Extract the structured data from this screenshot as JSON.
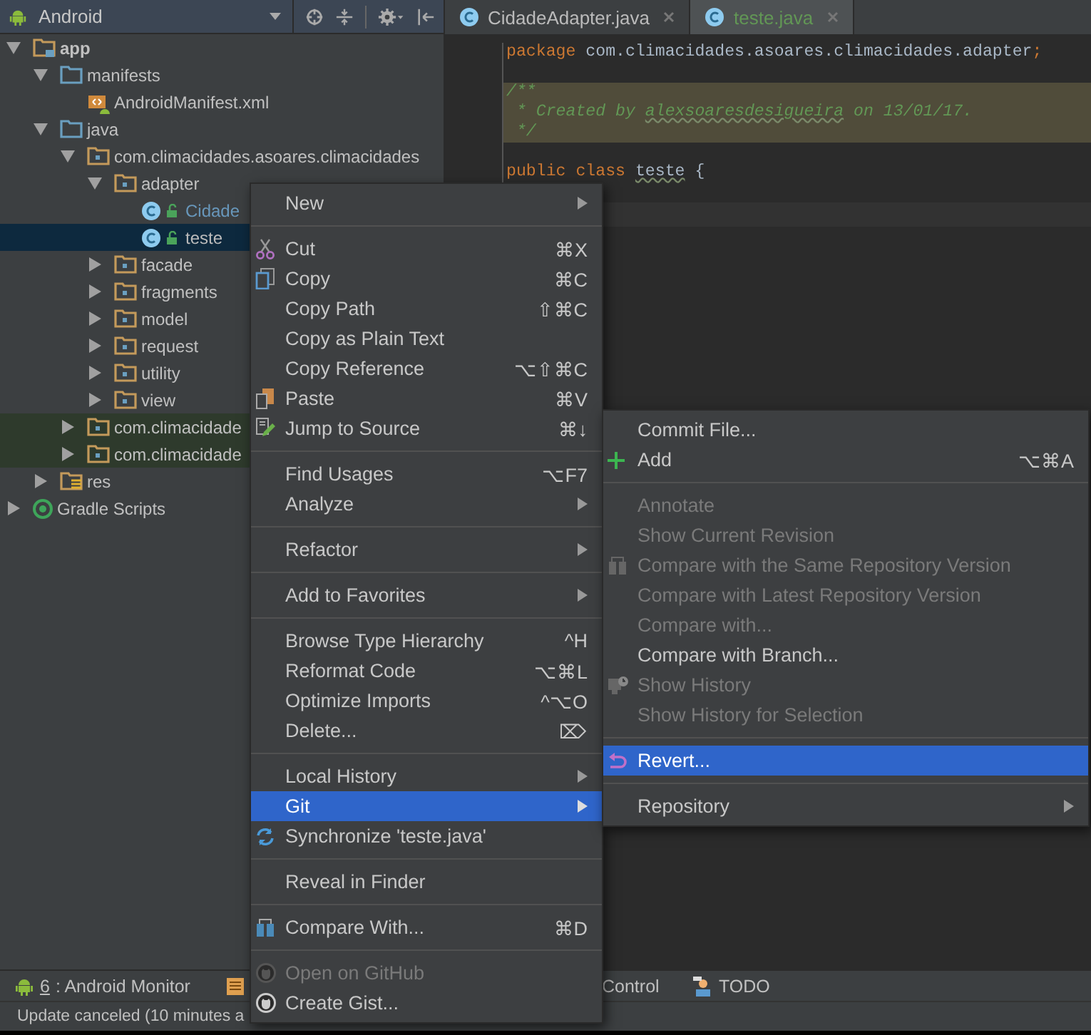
{
  "project_panel": {
    "view": "Android"
  },
  "tree": [
    {
      "label": "app",
      "kind": "module",
      "expanded": true,
      "children": [
        {
          "label": "manifests",
          "kind": "folder",
          "expanded": true,
          "children": [
            {
              "label": "AndroidManifest.xml",
              "kind": "manifest"
            }
          ]
        },
        {
          "label": "java",
          "kind": "folder",
          "expanded": true,
          "children": [
            {
              "label": "com.climacidades.asoares.climacidades",
              "kind": "package",
              "expanded": true,
              "children": [
                {
                  "label": "adapter",
                  "kind": "package",
                  "expanded": true,
                  "children": [
                    {
                      "label": "Cidade",
                      "kind": "class",
                      "selected": false,
                      "color": "#6897bb"
                    },
                    {
                      "label": "teste",
                      "kind": "class",
                      "selected": true,
                      "color": "#bbbbbb"
                    }
                  ]
                },
                {
                  "label": "facade",
                  "kind": "package",
                  "expanded": false
                },
                {
                  "label": "fragments",
                  "kind": "package",
                  "expanded": false
                },
                {
                  "label": "model",
                  "kind": "package",
                  "expanded": false
                },
                {
                  "label": "request",
                  "kind": "package",
                  "expanded": false
                },
                {
                  "label": "utility",
                  "kind": "package",
                  "expanded": false
                },
                {
                  "label": "view",
                  "kind": "package",
                  "expanded": false
                }
              ]
            },
            {
              "label": "com.climacidade",
              "kind": "test-package",
              "expanded": false
            },
            {
              "label": "com.climacidade",
              "kind": "test-package",
              "expanded": false
            }
          ]
        },
        {
          "label": "res",
          "kind": "res",
          "expanded": false
        }
      ]
    },
    {
      "label": "Gradle Scripts",
      "kind": "gradle",
      "expanded": false
    }
  ],
  "tabs": [
    {
      "label": "CidadeAdapter.java",
      "selected": false,
      "kind": "unchanged"
    },
    {
      "label": "teste.java",
      "selected": true,
      "kind": "added"
    }
  ],
  "code_lines": [
    {
      "tokens": [
        {
          "kind": "keyword",
          "text": "package"
        },
        {
          "kind": "plain",
          "text": " com.climacidades.asoares.climacidades.adapter"
        },
        {
          "kind": "keyword",
          "text": ";"
        }
      ],
      "highlighted": false,
      "current": false
    },
    {
      "highlighted": false,
      "current": false
    },
    {
      "tokens": [
        {
          "kind": "comment",
          "text": "/**"
        }
      ],
      "highlighted": true,
      "current": false
    },
    {
      "tokens": [
        {
          "kind": "comment",
          "text": " * Created by "
        },
        {
          "kind": "comment-typo",
          "text": "alexsoaresdesigueira"
        },
        {
          "kind": "comment",
          "text": " on 13/01/17."
        }
      ],
      "highlighted": true,
      "current": false
    },
    {
      "tokens": [
        {
          "kind": "comment",
          "text": " */"
        }
      ],
      "highlighted": true,
      "current": false
    },
    {
      "highlighted": false,
      "current": false
    },
    {
      "tokens": [
        {
          "kind": "keyword",
          "text": "public class "
        },
        {
          "kind": "typo",
          "text": "teste"
        },
        {
          "kind": "plain",
          "text": " {"
        }
      ],
      "highlighted": false,
      "current": false
    },
    {
      "highlighted": false,
      "current": false
    },
    {
      "highlighted": false,
      "current": true
    }
  ],
  "tool_bar": [
    {
      "kind": "android",
      "mnemonic": "6",
      "label": ": Android Monitor"
    },
    {
      "kind": "terminal"
    },
    {
      "kind": "plain",
      "label": "Control"
    },
    {
      "kind": "todo",
      "label": "TODO"
    }
  ],
  "status_bar": "Update canceled (10 minutes a",
  "context_menu": {
    "items": [
      {
        "kind": "item",
        "label": "New",
        "submenu": true,
        "disabled": false,
        "selected": false
      },
      {
        "kind": "separator"
      },
      {
        "kind": "cut",
        "label": "Cut",
        "shortcut": "⌘X",
        "disabled": false,
        "selected": false
      },
      {
        "kind": "copy",
        "label": "Copy",
        "shortcut": "⌘C",
        "disabled": false,
        "selected": false
      },
      {
        "kind": "item",
        "label": "Copy Path",
        "shortcut": "⇧⌘C",
        "disabled": false,
        "selected": false
      },
      {
        "kind": "item",
        "label": "Copy as Plain Text",
        "disabled": false,
        "selected": false
      },
      {
        "kind": "item",
        "label": "Copy Reference",
        "shortcut": "⌥⇧⌘C",
        "disabled": false,
        "selected": false
      },
      {
        "kind": "paste",
        "label": "Paste",
        "shortcut": "⌘V",
        "disabled": false,
        "selected": false
      },
      {
        "kind": "jump",
        "label": "Jump to Source",
        "shortcut": "⌘↓",
        "disabled": false,
        "selected": false
      },
      {
        "kind": "separator"
      },
      {
        "kind": "item",
        "label": "Find Usages",
        "shortcut": "⌥F7",
        "disabled": false,
        "selected": false
      },
      {
        "kind": "item",
        "label": "Analyze",
        "submenu": true,
        "disabled": false,
        "selected": false
      },
      {
        "kind": "separator"
      },
      {
        "kind": "item",
        "label": "Refactor",
        "submenu": true,
        "disabled": false,
        "selected": false
      },
      {
        "kind": "separator"
      },
      {
        "kind": "item",
        "label": "Add to Favorites",
        "submenu": true,
        "disabled": false,
        "selected": false
      },
      {
        "kind": "separator"
      },
      {
        "kind": "item",
        "label": "Browse Type Hierarchy",
        "shortcut": "^H",
        "disabled": false,
        "selected": false
      },
      {
        "kind": "item",
        "label": "Reformat Code",
        "shortcut": "⌥⌘L",
        "disabled": false,
        "selected": false
      },
      {
        "kind": "item",
        "label": "Optimize Imports",
        "shortcut": "^⌥O",
        "disabled": false,
        "selected": false
      },
      {
        "kind": "item",
        "label": "Delete...",
        "shortcut": "⌦",
        "disabled": false,
        "selected": false
      },
      {
        "kind": "separator"
      },
      {
        "kind": "item",
        "label": "Local History",
        "submenu": true,
        "disabled": false,
        "selected": false
      },
      {
        "kind": "item",
        "label": "Git",
        "submenu": true,
        "disabled": false,
        "selected": true
      },
      {
        "kind": "sync",
        "label": "Synchronize 'teste.java'",
        "disabled": false,
        "selected": false
      },
      {
        "kind": "separator"
      },
      {
        "kind": "item",
        "label": "Reveal in Finder",
        "disabled": false,
        "selected": false
      },
      {
        "kind": "separator"
      },
      {
        "kind": "compare",
        "label": "Compare With...",
        "shortcut": "⌘D",
        "disabled": false,
        "selected": false
      },
      {
        "kind": "separator"
      },
      {
        "kind": "github",
        "label": "Open on GitHub",
        "disabled": true,
        "selected": false
      },
      {
        "kind": "github",
        "label": "Create Gist...",
        "disabled": false,
        "selected": false
      }
    ]
  },
  "git_submenu": {
    "items": [
      {
        "kind": "item",
        "label": "Commit File...",
        "disabled": false,
        "selected": false
      },
      {
        "kind": "add",
        "label": "Add",
        "shortcut": "⌥⌘A",
        "disabled": false,
        "selected": false
      },
      {
        "kind": "separator"
      },
      {
        "kind": "item",
        "label": "Annotate",
        "disabled": true,
        "selected": false
      },
      {
        "kind": "item",
        "label": "Show Current Revision",
        "disabled": true,
        "selected": false
      },
      {
        "kind": "compare",
        "label": "Compare with the Same Repository Version",
        "disabled": true,
        "selected": false
      },
      {
        "kind": "item",
        "label": "Compare with Latest Repository Version",
        "disabled": true,
        "selected": false
      },
      {
        "kind": "item",
        "label": "Compare with...",
        "disabled": true,
        "selected": false
      },
      {
        "kind": "item",
        "label": "Compare with Branch...",
        "disabled": false,
        "selected": false
      },
      {
        "kind": "history",
        "label": "Show History",
        "disabled": true,
        "selected": false
      },
      {
        "kind": "item",
        "label": "Show History for Selection",
        "disabled": true,
        "selected": false
      },
      {
        "kind": "separator"
      },
      {
        "kind": "revert",
        "label": "Revert...",
        "disabled": false,
        "selected": true
      },
      {
        "kind": "separator"
      },
      {
        "kind": "item",
        "label": "Repository",
        "submenu": true,
        "disabled": false,
        "selected": false
      }
    ]
  }
}
